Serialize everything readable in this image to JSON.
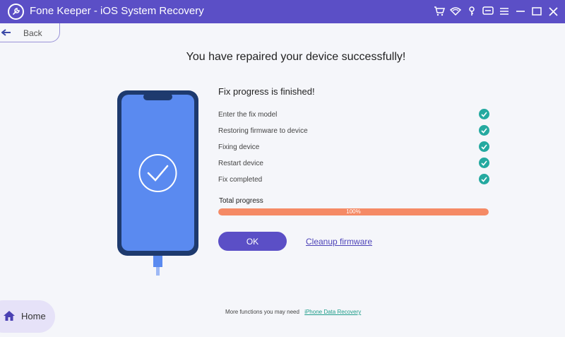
{
  "window": {
    "title": "Fone Keeper - iOS System Recovery",
    "toolbar_icons": [
      "cart-icon",
      "wifi-icon",
      "key-icon",
      "chat-icon",
      "menu-icon",
      "minimize-icon",
      "maximize-icon",
      "close-icon"
    ]
  },
  "nav": {
    "back_label": "Back",
    "home_label": "Home"
  },
  "main": {
    "headline": "You have repaired your device successfully!",
    "fix_title": "Fix progress is finished!",
    "steps": [
      {
        "label": "Enter the fix model",
        "done": true
      },
      {
        "label": "Restoring firmware to device",
        "done": true
      },
      {
        "label": "Fixing device",
        "done": true
      },
      {
        "label": "Restart device",
        "done": true
      },
      {
        "label": "Fix completed",
        "done": true
      }
    ],
    "total_label": "Total progress",
    "progress_percent": 100,
    "progress_text": "100%",
    "ok_label": "OK",
    "cleanup_label": "Cleanup firmware"
  },
  "footer": {
    "text": "More functions you may need",
    "link": "iPhone Data Recovery"
  },
  "colors": {
    "brand": "#5b4fc6",
    "check": "#24a9a0",
    "progress": "#f58a65",
    "phone_screen": "#5a8af0",
    "phone_body": "#1e3a6e"
  }
}
